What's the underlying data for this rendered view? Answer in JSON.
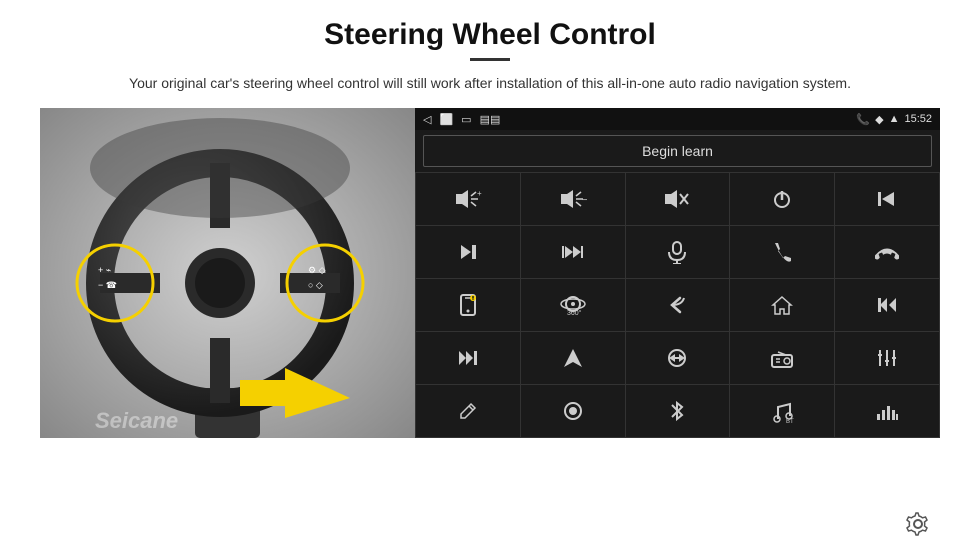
{
  "header": {
    "title": "Steering Wheel Control",
    "subtitle": "Your original car's steering wheel control will still work after installation of this all-in-one auto radio navigation system."
  },
  "statusBar": {
    "time": "15:52",
    "icons": [
      "back",
      "home",
      "recents",
      "sim",
      "wifi",
      "phone",
      "location"
    ]
  },
  "beginLearnButton": {
    "label": "Begin learn"
  },
  "iconGrid": [
    {
      "icon": "🔊+",
      "name": "vol-up"
    },
    {
      "icon": "🔊−",
      "name": "vol-down"
    },
    {
      "icon": "🔇",
      "name": "mute"
    },
    {
      "icon": "⏻",
      "name": "power"
    },
    {
      "icon": "⏮",
      "name": "prev-track"
    },
    {
      "icon": "⏭",
      "name": "next"
    },
    {
      "icon": "⏭⏭",
      "name": "fast-forward"
    },
    {
      "icon": "🎤",
      "name": "mic"
    },
    {
      "icon": "📞",
      "name": "call"
    },
    {
      "icon": "📞↩",
      "name": "hang-up"
    },
    {
      "icon": "📱",
      "name": "phone-source"
    },
    {
      "icon": "👁360",
      "name": "360-view"
    },
    {
      "icon": "↩",
      "name": "back"
    },
    {
      "icon": "🏠",
      "name": "home"
    },
    {
      "icon": "⏮⏮",
      "name": "rewind"
    },
    {
      "icon": "⏭⏭",
      "name": "skip-forward"
    },
    {
      "icon": "➤",
      "name": "navigate"
    },
    {
      "icon": "⇄",
      "name": "swap"
    },
    {
      "icon": "📻",
      "name": "radio"
    },
    {
      "icon": "⇅",
      "name": "equalizer"
    },
    {
      "icon": "✏",
      "name": "edit"
    },
    {
      "icon": "⏺",
      "name": "record"
    },
    {
      "icon": "✱",
      "name": "bluetooth"
    },
    {
      "icon": "🎵",
      "name": "music"
    },
    {
      "icon": "📊",
      "name": "spectrum"
    }
  ],
  "watermark": "Seicane",
  "settingsIcon": "⚙"
}
